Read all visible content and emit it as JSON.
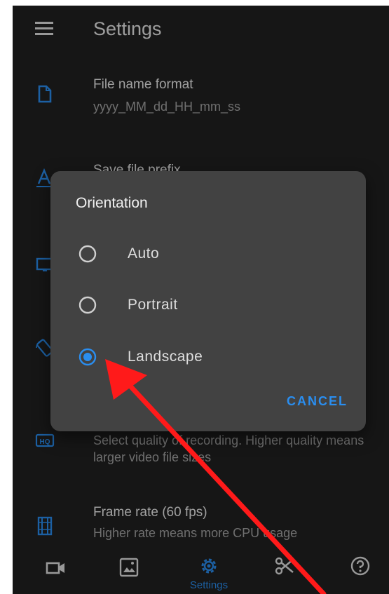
{
  "app": {
    "title": "Settings"
  },
  "settings": [
    {
      "title": "File name format",
      "subtitle": "yyyy_MM_dd_HH_mm_ss",
      "icon": "file-icon"
    },
    {
      "title": "Save file prefix",
      "subtitle": "",
      "icon": "text-format-icon"
    },
    {
      "title": "",
      "subtitle": "",
      "icon": "monitor-icon"
    },
    {
      "title": "",
      "subtitle": "",
      "icon": "screen-rotation-icon"
    },
    {
      "title": "",
      "subtitle": "Select quality of recording. Higher quality means larger video file sizes",
      "icon": "hd-icon"
    },
    {
      "title": "Frame rate (60 fps)",
      "subtitle": "Higher rate means more CPU usage",
      "icon": "film-icon"
    }
  ],
  "dialog": {
    "title": "Orientation",
    "options": [
      {
        "label": "Auto",
        "selected": false
      },
      {
        "label": "Portrait",
        "selected": false
      },
      {
        "label": "Landscape",
        "selected": true
      }
    ],
    "cancel_label": "CANCEL"
  },
  "bottom_nav": {
    "items": [
      {
        "icon": "video-camera-icon",
        "label": ""
      },
      {
        "icon": "gallery-icon",
        "label": ""
      },
      {
        "icon": "settings-gear-icon",
        "label": "Settings",
        "active": true
      },
      {
        "icon": "scissors-icon",
        "label": ""
      },
      {
        "icon": "help-icon",
        "label": ""
      }
    ]
  },
  "colors": {
    "background": "#212121",
    "dialog": "#424242",
    "accent": "#2a8ef0",
    "annotation_arrow": "#ff1a1a"
  }
}
